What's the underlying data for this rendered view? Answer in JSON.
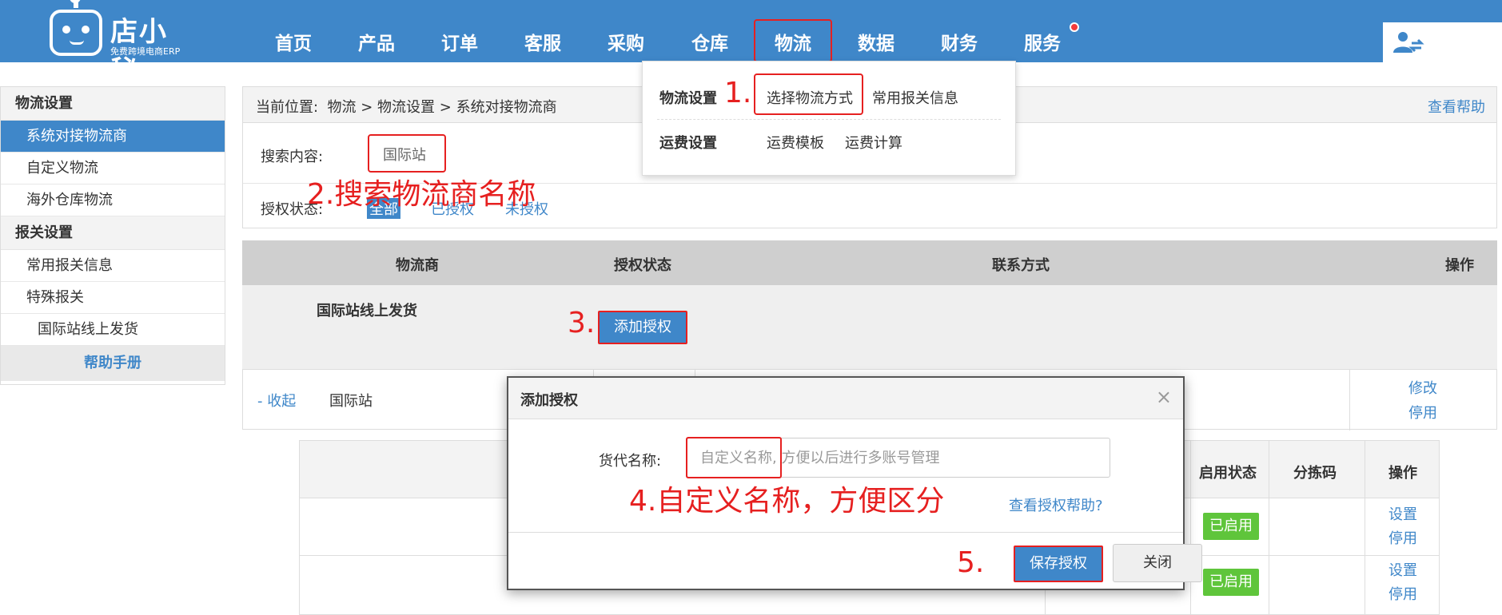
{
  "logo": {
    "name": "店小秘",
    "tagline": "免费跨境电商ERP"
  },
  "nav": {
    "items": [
      "首页",
      "产品",
      "订单",
      "客服",
      "采购",
      "仓库",
      "物流",
      "数据",
      "财务",
      "服务"
    ],
    "active": "物流"
  },
  "dropdown": {
    "section1_title": "物流设置",
    "section1_links": [
      "选择物流方式",
      "常用报关信息"
    ],
    "section2_title": "运费设置",
    "section2_links": [
      "运费模板",
      "运费计算"
    ]
  },
  "sidebar": {
    "section1": "物流设置",
    "items1": [
      "系统对接物流商",
      "自定义物流",
      "海外仓库物流"
    ],
    "section2": "报关设置",
    "items2": [
      "常用报关信息",
      "特殊报关"
    ],
    "sub_item": "国际站线上发货",
    "help": "帮助手册"
  },
  "breadcrumb": {
    "label": "当前位置:",
    "path": "物流 > 物流设置 > 系统对接物流商",
    "help": "查看帮助"
  },
  "filter": {
    "search_label": "搜索内容:",
    "search_value": "国际站",
    "status_label": "授权状态:",
    "status_options": [
      "全部",
      "已授权",
      "未授权"
    ]
  },
  "table": {
    "headers": [
      "物流商",
      "授权状态",
      "联系方式",
      "操作"
    ],
    "group_name": "国际站线上发货",
    "add_button": "添加授权",
    "row": {
      "collapse": "- 收起",
      "name": "国际站",
      "ops": [
        "修改",
        "停用"
      ]
    }
  },
  "sub_table": {
    "headers": [
      "启用状态",
      "分拣码",
      "操作"
    ],
    "rows": [
      {
        "status": "已启用",
        "ops": [
          "设置",
          "停用"
        ]
      },
      {
        "status": "已启用",
        "ops": [
          "设置",
          "停用"
        ]
      }
    ]
  },
  "modal": {
    "title": "添加授权",
    "close_symbol": "×",
    "label": "货代名称:",
    "placeholder": "自定义名称, 方便以后进行多账号管理",
    "help": "查看授权帮助?",
    "save": "保存授权",
    "close": "关闭"
  },
  "annotations": {
    "step1": "1.",
    "step2": "2.搜索物流商名称",
    "step3": "3.",
    "step4": "4.自定义名称，方便区分",
    "step5": "5."
  },
  "colors": {
    "primary": "#3f87c9",
    "annotation": "#e62020",
    "enabled": "#5fc53b"
  }
}
